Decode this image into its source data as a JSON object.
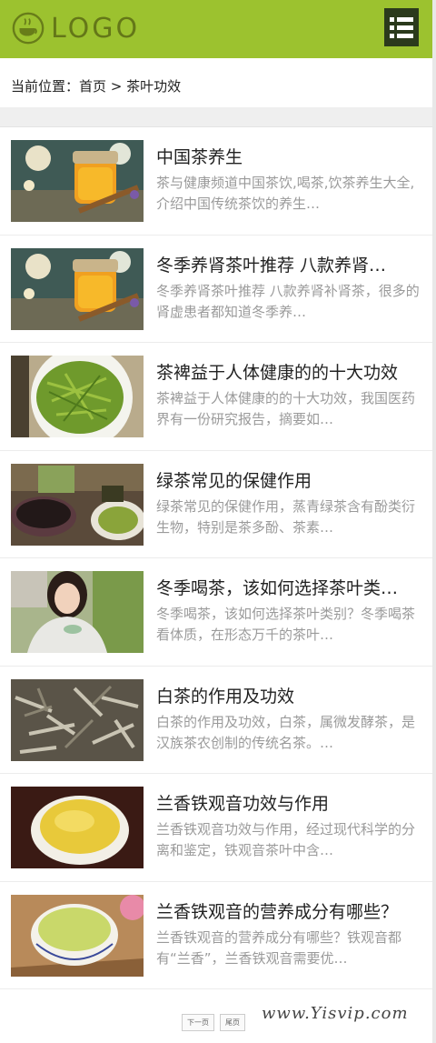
{
  "header": {
    "logo_text": "LOGO",
    "brand_color": "#9cc22f",
    "menu_icon": "menu-list-icon"
  },
  "breadcrumb": {
    "prefix": "当前位置：",
    "home": "首页",
    "separator": " > ",
    "current": "茶叶功效"
  },
  "articles": [
    {
      "title": "中国茶养生",
      "desc": "茶与健康频道中国茶饮,喝茶,饮茶养生大全,介绍中国传统茶饮的养生…",
      "image": "honey-jar-image"
    },
    {
      "title": "冬季养肾茶叶推荐 八款养肾…",
      "desc": "冬季养肾茶叶推荐 八款养肾补肾茶，很多的肾虚患者都知道冬季养…",
      "image": "honey-jar-image"
    },
    {
      "title": "茶裨益于人体健康的的十大功效",
      "desc": "茶裨益于人体健康的的十大功效，我国医药界有一份研究报告，摘要如…",
      "image": "green-tea-bowl-image"
    },
    {
      "title": "绿茶常见的保健作用",
      "desc": "绿茶常见的保健作用，蒸青绿茶含有酚类衍生物，特别是茶多酚、茶素…",
      "image": "tea-set-image"
    },
    {
      "title": "冬季喝茶，该如何选择茶叶类…",
      "desc": "冬季喝茶，该如何选择茶叶类别？冬季喝茶看体质，在形态万千的茶叶…",
      "image": "woman-tea-cup-image"
    },
    {
      "title": "白茶的作用及功效",
      "desc": "白茶的作用及功效，白茶，属微发酵茶，是汉族茶农创制的传统名茶。…",
      "image": "white-tea-leaves-image"
    },
    {
      "title": "兰香铁观音功效与作用",
      "desc": "兰香铁观音功效与作用，经过现代科学的分离和鉴定，铁观音茶叶中含…",
      "image": "yellow-tea-cup-image"
    },
    {
      "title": "兰香铁观音的营养成分有哪些？",
      "desc": "兰香铁观音的营养成分有哪些？铁观音都有“兰香”，兰香铁观音需要优…",
      "image": "tea-cup-flower-image"
    }
  ],
  "pager": {
    "next": "下一页",
    "last": "尾页"
  },
  "watermark": "www.Yisvip.com"
}
